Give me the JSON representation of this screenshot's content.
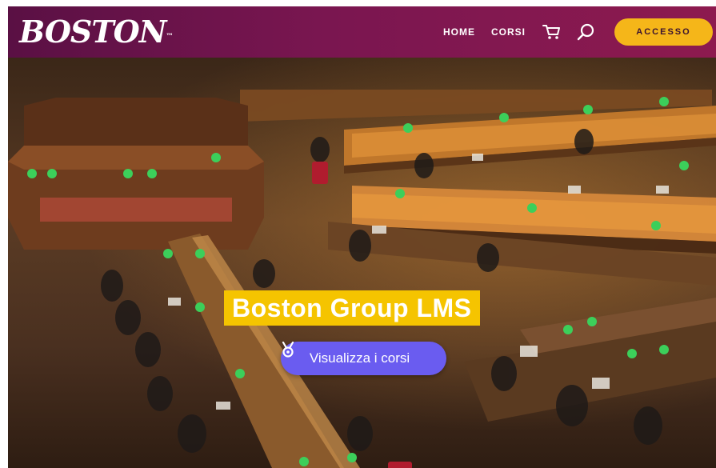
{
  "header": {
    "logo_text": "BOSTON",
    "logo_mark": "™",
    "nav": {
      "home": "HOME",
      "courses": "CORSI"
    },
    "login_label": "ACCESSO"
  },
  "hero": {
    "title": "Boston Group LMS",
    "cta_label": "Visualizza i corsi"
  },
  "icons": {
    "cart": "cart-icon",
    "search": "search-icon",
    "cta": "medal-icon"
  },
  "colors": {
    "header_start": "#5a1044",
    "header_end": "#8d1a4f",
    "accent_yellow": "#f5b619",
    "title_bg": "#f5c400",
    "cta_bg": "#6a5cf0"
  }
}
